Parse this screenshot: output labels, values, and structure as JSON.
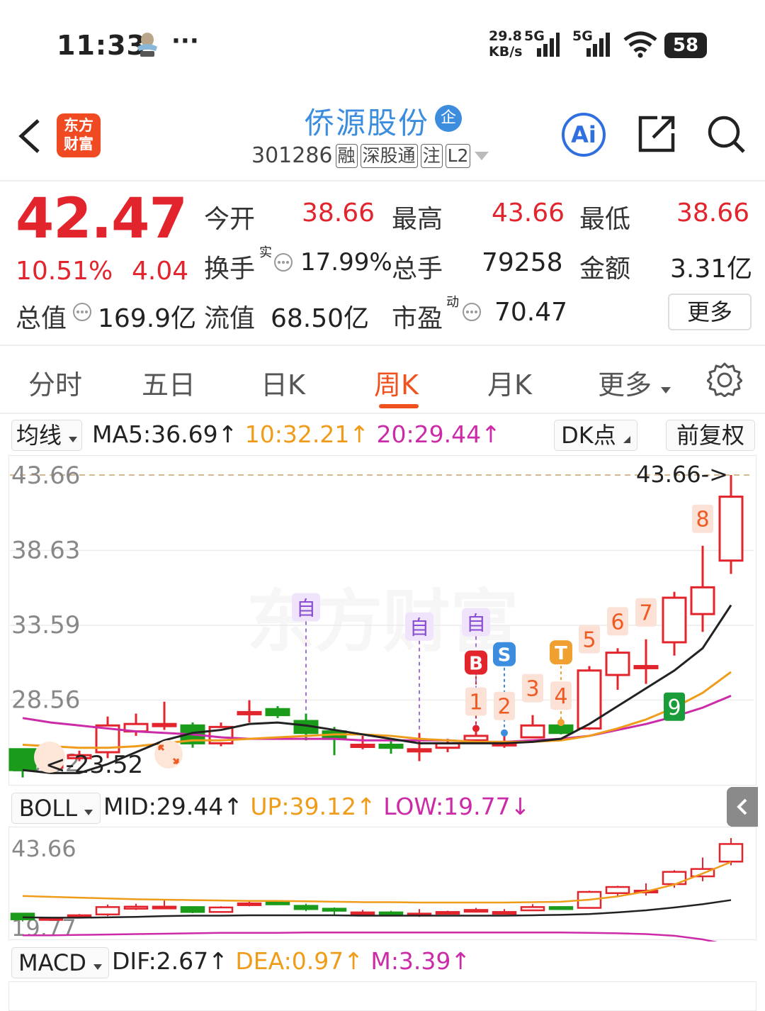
{
  "status_bar": {
    "time": "11:33",
    "more": "···",
    "net_speed_value": "29.8",
    "net_speed_unit": "KB/s",
    "sig1": "5G",
    "sig2": "5G",
    "battery": "58"
  },
  "nav": {
    "stock_name": "侨源股份",
    "ent_badge": "企",
    "code": "301286",
    "tags": [
      "融",
      "深股通",
      "注",
      "L2"
    ],
    "logo_line1": "东方",
    "logo_line2": "财富",
    "ai_label": "Ai"
  },
  "quote": {
    "price": "42.47",
    "change_pct": "10.51%",
    "change_amt": "4.04",
    "open_label": "今开",
    "open": "38.66",
    "high_label": "最高",
    "high": "43.66",
    "low_label": "最低",
    "low": "38.66",
    "turnover_label": "换手",
    "turnover_sup": "实",
    "turnover": "17.99%",
    "volume_label": "总手",
    "volume": "79258",
    "amount_label": "金额",
    "amount": "3.31亿",
    "mktcap_label": "总值",
    "mktcap": "169.9亿",
    "float_label": "流值",
    "float_cap": "68.50亿",
    "pe_label": "市盈",
    "pe_sup": "动",
    "pe": "70.47",
    "more": "更多"
  },
  "tabs": [
    {
      "label": "分时"
    },
    {
      "label": "五日"
    },
    {
      "label": "日K"
    },
    {
      "label": "周K"
    },
    {
      "label": "月K"
    },
    {
      "label": "更多"
    }
  ],
  "active_tab": "周K",
  "ma_row": {
    "selector": "均线",
    "ma5": "MA5:36.69",
    "ma10": "10:32.21",
    "ma20": "20:29.44",
    "dk": "DK点",
    "fq": "前复权"
  },
  "boll_row": {
    "selector": "BOLL",
    "mid": "MID:29.44",
    "up": "UP:39.12",
    "low": "LOW:19.77"
  },
  "macd_row": {
    "selector": "MACD",
    "dif": "DIF:2.67",
    "dea": "DEA:0.97",
    "m": "M:3.39"
  },
  "colors": {
    "up": "#e2242c",
    "down": "#1a9c1a",
    "ma5": "#222222",
    "ma10": "#f09c1b",
    "ma20": "#cc2ba8",
    "accent": "#f0521f",
    "blue": "#3c8dde"
  },
  "chart_data": [
    {
      "type": "candlestick",
      "title": "周K",
      "y_tick_labels": [
        "43.66",
        "38.63",
        "33.59",
        "28.56",
        "23.52"
      ],
      "ylim": [
        23.52,
        43.66
      ],
      "high_marker": "43.66->",
      "low_marker": "<-23.52",
      "watermark": "东方财富",
      "candles": [
        {
          "o": 25.2,
          "c": 23.8,
          "h": 25.2,
          "l": 23.3
        },
        {
          "o": 24.1,
          "c": 24.1,
          "h": 24.4,
          "l": 23.7
        },
        {
          "o": 24.6,
          "c": 24.8,
          "h": 25.1,
          "l": 24.4
        },
        {
          "o": 25.0,
          "c": 26.8,
          "h": 27.4,
          "l": 24.6
        },
        {
          "o": 26.4,
          "c": 26.9,
          "h": 27.6,
          "l": 26.1
        },
        {
          "o": 26.8,
          "c": 26.9,
          "h": 28.4,
          "l": 26.5
        },
        {
          "o": 26.8,
          "c": 25.6,
          "h": 27.0,
          "l": 25.3
        },
        {
          "o": 25.6,
          "c": 26.7,
          "h": 27.0,
          "l": 25.4
        },
        {
          "o": 27.7,
          "c": 27.7,
          "h": 28.5,
          "l": 27.0
        },
        {
          "o": 27.9,
          "c": 27.5,
          "h": 28.1,
          "l": 27.3
        },
        {
          "o": 27.1,
          "c": 26.3,
          "h": 27.6,
          "l": 25.8
        },
        {
          "o": 26.4,
          "c": 25.9,
          "h": 26.7,
          "l": 24.8
        },
        {
          "o": 25.5,
          "c": 25.5,
          "h": 26.1,
          "l": 25.2
        },
        {
          "o": 25.5,
          "c": 25.3,
          "h": 25.9,
          "l": 24.9
        },
        {
          "o": 25.2,
          "c": 25.2,
          "h": 26.3,
          "l": 24.4
        },
        {
          "o": 25.3,
          "c": 25.6,
          "h": 25.9,
          "l": 25.0
        },
        {
          "o": 25.8,
          "c": 26.1,
          "h": 26.6,
          "l": 25.8
        },
        {
          "o": 25.6,
          "c": 25.6,
          "h": 26.3,
          "l": 25.3
        },
        {
          "o": 26.0,
          "c": 26.8,
          "h": 27.5,
          "l": 26.0
        },
        {
          "o": 26.8,
          "c": 26.3,
          "h": 27.0,
          "l": 26.2
        },
        {
          "o": 26.6,
          "c": 30.5,
          "h": 30.8,
          "l": 26.5
        },
        {
          "o": 30.2,
          "c": 31.7,
          "h": 32.0,
          "l": 29.2
        },
        {
          "o": 30.8,
          "c": 30.8,
          "h": 32.6,
          "l": 29.6
        },
        {
          "o": 32.4,
          "c": 35.4,
          "h": 35.8,
          "l": 31.5
        },
        {
          "o": 34.3,
          "c": 36.1,
          "h": 38.9,
          "l": 33.1
        },
        {
          "o": 37.9,
          "c": 42.2,
          "h": 43.66,
          "l": 37.0
        }
      ],
      "ma5": [
        23.8,
        23.6,
        23.6,
        24.2,
        25.0,
        25.8,
        26.3,
        26.5,
        26.9,
        27.0,
        26.8,
        26.5,
        26.2,
        25.9,
        25.6,
        25.6,
        25.6,
        25.6,
        25.7,
        25.9,
        26.9,
        28.1,
        29.3,
        30.5,
        32.0,
        34.9
      ],
      "ma10": [
        25.5,
        25.4,
        25.3,
        25.3,
        25.4,
        25.6,
        25.8,
        25.8,
        25.9,
        26.0,
        26.1,
        26.2,
        26.2,
        26.1,
        25.9,
        25.8,
        25.7,
        25.7,
        25.7,
        25.8,
        26.1,
        26.6,
        27.2,
        28.0,
        29.0,
        30.4
      ],
      "ma20": [
        27.3,
        27.0,
        26.8,
        26.6,
        26.4,
        26.3,
        26.2,
        26.0,
        25.9,
        25.9,
        25.9,
        25.9,
        25.8,
        25.8,
        25.8,
        25.8,
        25.7,
        25.7,
        25.8,
        25.9,
        26.1,
        26.5,
        26.9,
        27.4,
        28.0,
        28.8
      ],
      "annotations": [
        {
          "i": 10,
          "text": "自",
          "kind": "self"
        },
        {
          "i": 14,
          "text": "自",
          "kind": "self"
        },
        {
          "i": 16,
          "text": "自",
          "kind": "self"
        },
        {
          "i": 16,
          "text": "B",
          "kind": "buy"
        },
        {
          "i": 17,
          "text": "S",
          "kind": "sell"
        },
        {
          "i": 19,
          "text": "T",
          "kind": "t"
        },
        {
          "i": 16,
          "text": "1",
          "kind": "count"
        },
        {
          "i": 17,
          "text": "2",
          "kind": "count"
        },
        {
          "i": 18,
          "text": "3",
          "kind": "count"
        },
        {
          "i": 19,
          "text": "4",
          "kind": "count"
        },
        {
          "i": 20,
          "text": "5",
          "kind": "count"
        },
        {
          "i": 21,
          "text": "6",
          "kind": "count"
        },
        {
          "i": 22,
          "text": "7",
          "kind": "count"
        },
        {
          "i": 24,
          "text": "8",
          "kind": "count"
        },
        {
          "i": 23,
          "text": "9",
          "kind": "green"
        }
      ]
    },
    {
      "type": "candlestick",
      "title": "BOLL",
      "y_tick_labels": [
        "43.66",
        "19.77"
      ],
      "ylim": [
        19.77,
        43.66
      ],
      "up": [
        29.5,
        29.3,
        29.1,
        28.9,
        28.7,
        28.6,
        28.5,
        28.4,
        28.3,
        28.3,
        28.2,
        28.1,
        28.0,
        28.0,
        27.9,
        27.9,
        27.9,
        27.9,
        28.0,
        28.1,
        28.6,
        29.4,
        30.6,
        32.3,
        35.0,
        37.8
      ],
      "mid": [
        24.3,
        24.2,
        24.2,
        24.3,
        24.4,
        24.6,
        24.7,
        24.7,
        24.8,
        24.8,
        24.8,
        24.8,
        24.7,
        24.7,
        24.7,
        24.7,
        24.7,
        24.7,
        24.8,
        24.9,
        25.1,
        25.5,
        26.0,
        26.7,
        27.5,
        28.5
      ],
      "low": [
        19.9,
        19.9,
        20.0,
        20.1,
        20.2,
        20.3,
        20.4,
        20.5,
        20.5,
        20.5,
        20.6,
        20.6,
        20.6,
        20.6,
        20.6,
        20.6,
        20.6,
        20.6,
        20.6,
        20.6,
        20.5,
        20.4,
        20.2,
        19.8,
        18.9,
        17.5
      ]
    }
  ]
}
